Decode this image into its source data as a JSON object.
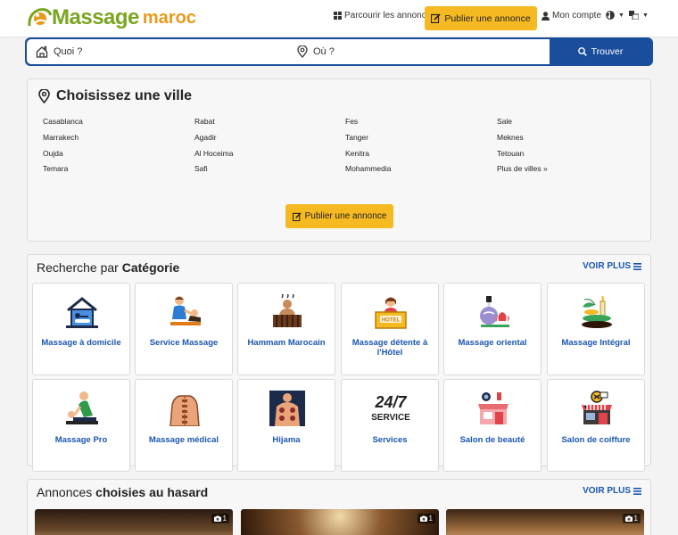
{
  "header": {
    "logo_main": "Massage",
    "logo_sub": "maroc",
    "browse_label": "Parcourir les annonces",
    "publish_label": "Publier une annonce",
    "account_label": "Mon compte"
  },
  "search": {
    "what_placeholder": "Quoi ?",
    "where_placeholder": "Où ?",
    "button_label": "Trouver"
  },
  "cities": {
    "title": "Choisissez une ville",
    "items": [
      "Casablanca",
      "Rabat",
      "Fes",
      "Sale",
      "Marrakech",
      "Agadir",
      "Tanger",
      "Meknes",
      "Oujda",
      "Al Hoceima",
      "Kenitra",
      "Tetouan",
      "Temara",
      "Safi",
      "Mohammedia",
      "Plus de villes »"
    ],
    "publish_label": "Publier une annonce"
  },
  "categories": {
    "title_prefix": "Recherche par",
    "title_bold": "Catégorie",
    "more_label": "VOIR PLUS",
    "items": [
      {
        "label": "Massage à domicile",
        "icon": "home-massage-icon"
      },
      {
        "label": "Service Massage",
        "icon": "therapist-icon"
      },
      {
        "label": "Hammam Marocain",
        "icon": "hammam-icon"
      },
      {
        "label": "Massage détente à l'Hôtel",
        "icon": "hotel-reception-icon"
      },
      {
        "label": "Massage oriental",
        "icon": "oil-lotus-icon"
      },
      {
        "label": "Massage Intégral",
        "icon": "spa-stones-icon"
      },
      {
        "label": "Massage Pro",
        "icon": "pro-massage-icon"
      },
      {
        "label": "Massage médical",
        "icon": "spine-icon"
      },
      {
        "label": "Hijama",
        "icon": "hijama-icon"
      },
      {
        "label": "Services",
        "icon": "service-24-7-icon"
      },
      {
        "label": "Salon de beauté",
        "icon": "beauty-salon-icon"
      },
      {
        "label": "Salon de coiffure",
        "icon": "hair-salon-icon"
      }
    ],
    "service_icon_text": {
      "top": "24/7",
      "bottom": "SERVICE"
    },
    "hotel_sign": "HOTEL"
  },
  "random": {
    "title_prefix": "Annonces",
    "title_bold": "choisies au hasard",
    "more_label": "VOIR PLUS",
    "photo_counts": [
      "1",
      "1",
      "1"
    ]
  },
  "colors": {
    "brand_green": "#7aa51f",
    "brand_orange": "#e89a1c",
    "primary_blue": "#1a4e9c",
    "link_blue": "#1a56b0",
    "accent_yellow": "#f5b921"
  }
}
